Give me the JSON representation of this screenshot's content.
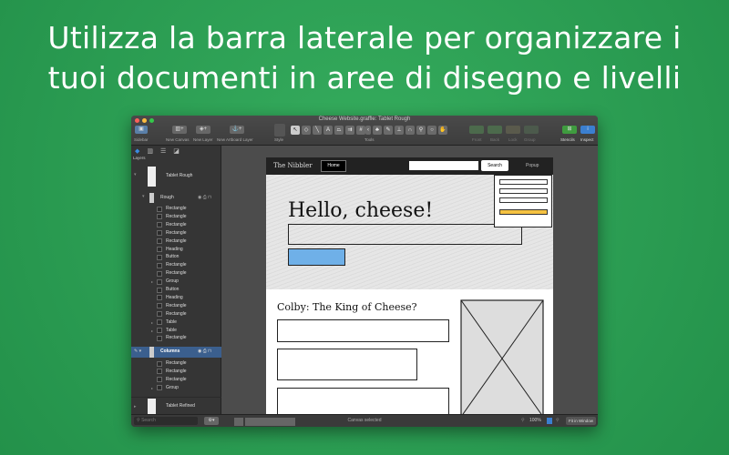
{
  "headline": {
    "line1": "Utilizza la barra laterale per organizzare i",
    "line2": "tuoi documenti in aree di disegno e livelli"
  },
  "window": {
    "title": "Cheese Website.graffle: Tablet Rough"
  },
  "toolbar": {
    "sidebar": "Sidebar",
    "new_canvas": "New Canvas",
    "new_layer": "New Layer",
    "new_artboard_layer": "New Artboard Layer",
    "style": "Style",
    "tools": "Tools",
    "front": "Front",
    "back": "Back",
    "lock": "Lock",
    "group": "Group",
    "stencils": "Stencils",
    "inspect": "Inspect"
  },
  "sidebar": {
    "header": "Layers",
    "canvas1": "Tablet Rough",
    "layer1": "Rough",
    "layer1_items": [
      "Rectangle",
      "Rectangle",
      "Rectangle",
      "Rectangle",
      "Rectangle",
      "Heading",
      "Button",
      "Rectangle",
      "Rectangle",
      "Group",
      "Button",
      "Heading",
      "Rectangle",
      "Rectangle",
      "Table",
      "Table",
      "Rectangle"
    ],
    "layer2": "Columns",
    "layer2_items": [
      "Rectangle",
      "Rectangle",
      "Rectangle",
      "Group"
    ],
    "canvas2": "Tablet Refined",
    "search_placeholder": "Search"
  },
  "artboard": {
    "brand": "The Nibbler",
    "home": "Home",
    "search_btn": "Search",
    "popup": "Popup",
    "hero_title": "Hello, cheese!",
    "section_title": "Colby: The King of Cheese?"
  },
  "status": {
    "text": "Canvas selected",
    "zoom": "100%",
    "fit": "Fit in Window"
  },
  "colors": {
    "accent": "#3b6eb5",
    "bg": "#2fa356",
    "highlight": "#f5c242",
    "button": "#6fb0e8"
  }
}
